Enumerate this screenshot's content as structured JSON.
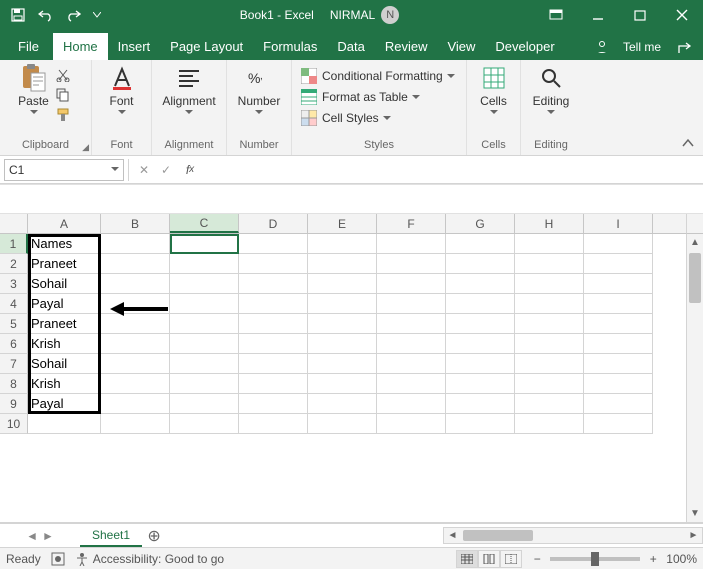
{
  "title": {
    "doc": "Book1 - Excel",
    "user": "NIRMAL",
    "user_initial": "N"
  },
  "tabs": [
    "File",
    "Home",
    "Insert",
    "Page Layout",
    "Formulas",
    "Data",
    "Review",
    "View",
    "Developer"
  ],
  "tell_me": "Tell me",
  "ribbon": {
    "clipboard": {
      "paste": "Paste",
      "title": "Clipboard"
    },
    "font": {
      "label": "Font",
      "title": "Font"
    },
    "alignment": {
      "label": "Alignment",
      "title": "Alignment"
    },
    "number": {
      "label": "Number",
      "title": "Number"
    },
    "styles": {
      "cond_fmt": "Conditional Formatting",
      "fmt_table": "Format as Table",
      "cell_styles": "Cell Styles",
      "title": "Styles"
    },
    "cells": {
      "label": "Cells",
      "title": "Cells"
    },
    "editing": {
      "label": "Editing",
      "title": "Editing"
    }
  },
  "namebox": "C1",
  "columns": [
    "A",
    "B",
    "C",
    "D",
    "E",
    "F",
    "G",
    "H",
    "I"
  ],
  "rows": [
    1,
    2,
    3,
    4,
    5,
    6,
    7,
    8,
    9,
    10
  ],
  "data_col_a": [
    "Names",
    "Praneet",
    "Sohail",
    "Payal",
    "Praneet",
    "Krish",
    "Sohail",
    "Krish",
    "Payal",
    ""
  ],
  "sheet": {
    "name": "Sheet1"
  },
  "status": {
    "ready": "Ready",
    "accessibility": "Accessibility: Good to go",
    "zoom": "100%"
  }
}
